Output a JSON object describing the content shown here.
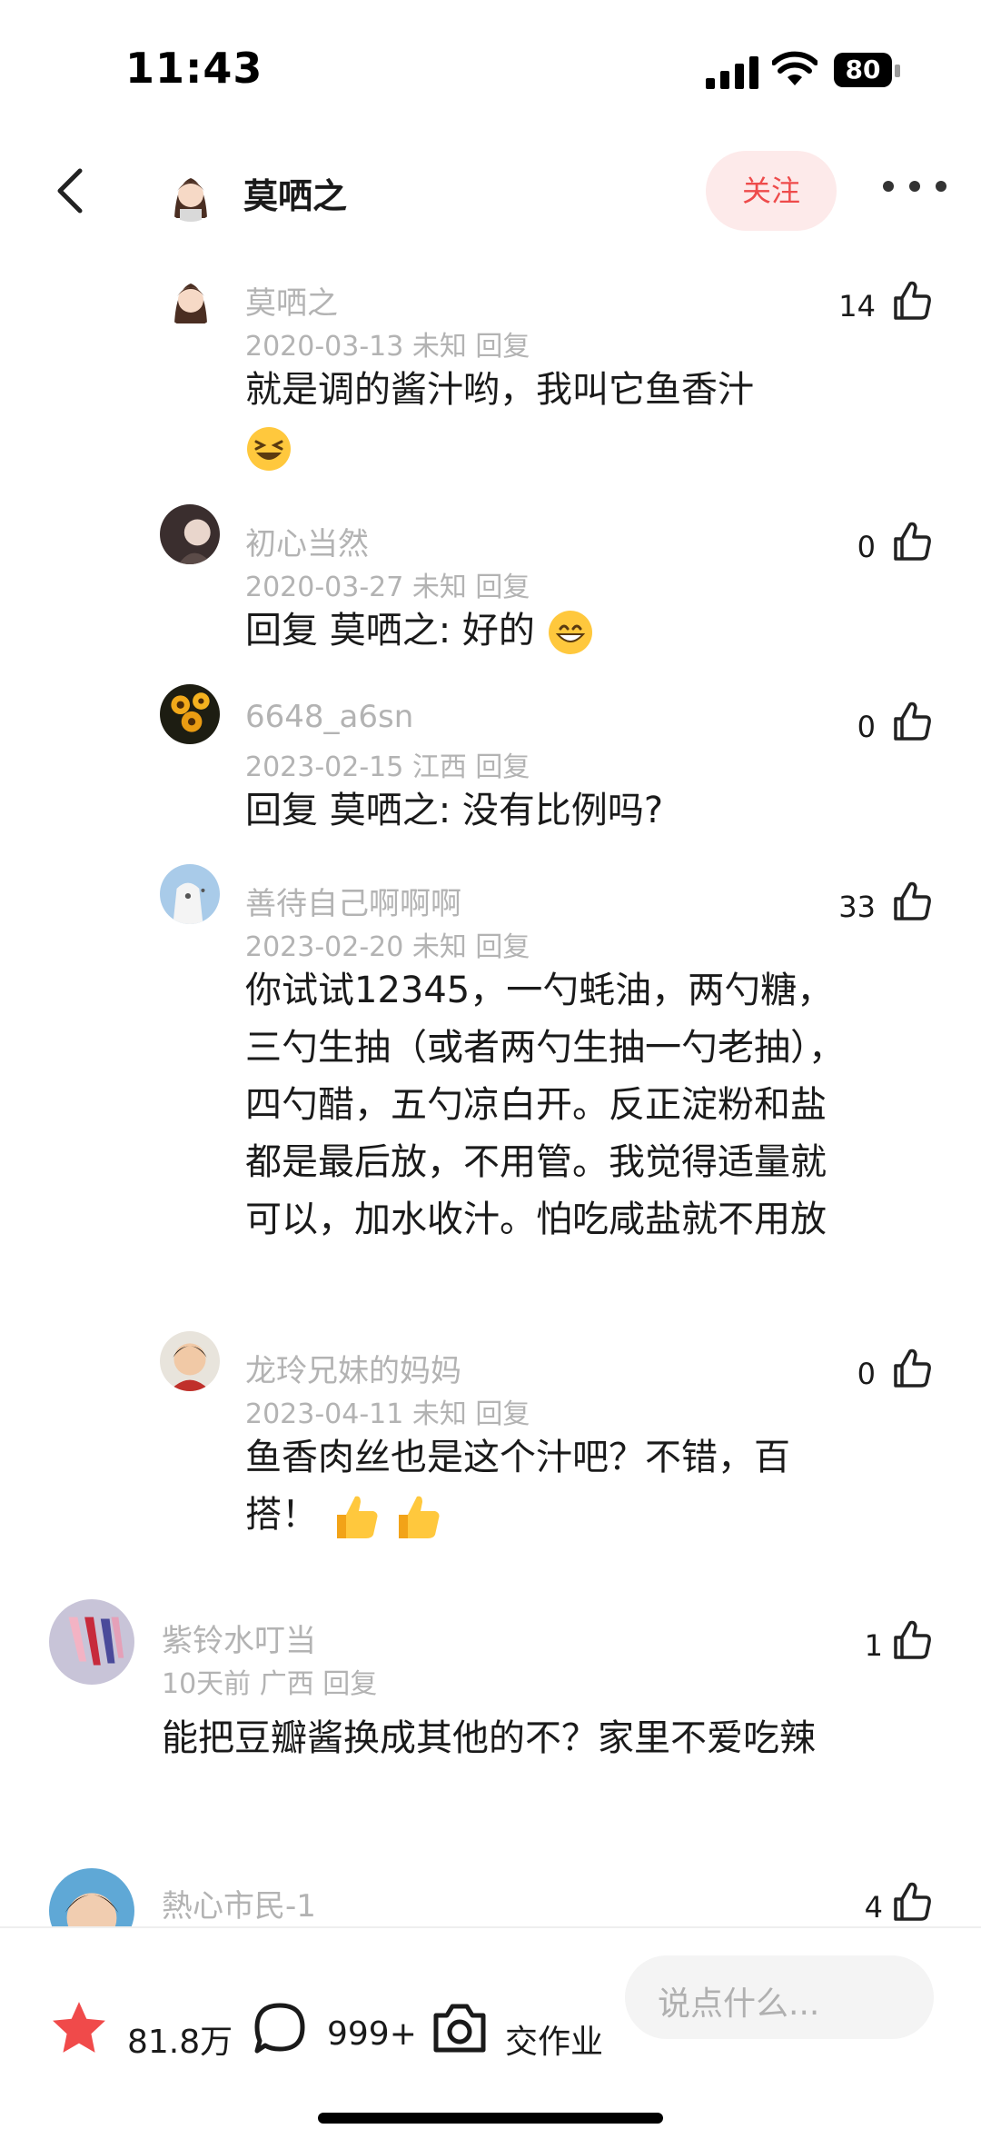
{
  "status_bar": {
    "time": "11:43",
    "battery": "80"
  },
  "header": {
    "author_name": "莫哂之",
    "follow_label": "关注"
  },
  "comments": [
    {
      "name": "莫哂之",
      "meta": "2020-03-13 未知 回复",
      "likes": "14",
      "text": "就是调的酱汁哟，我叫它鱼香汁"
    },
    {
      "name": "初心当然",
      "meta": "2020-03-27 未知 回复",
      "likes": "0",
      "text": "回复 莫哂之: 好的"
    },
    {
      "name": "6648_a6sn",
      "meta": "2023-02-15 江西 回复",
      "likes": "0",
      "text": "回复 莫哂之: 没有比例吗?"
    },
    {
      "name": "善待自己啊啊啊",
      "meta": "2023-02-20 未知 回复",
      "likes": "33",
      "text": "你试试12345，一勺蚝油，两勺糖，三勺生抽（或者两勺生抽一勺老抽），四勺醋，五勺凉白开。反正淀粉和盐都是最后放，不用管。我觉得适量就可以，加水收汁。怕吃咸盐就不用放"
    },
    {
      "name": "龙玲兄妹的妈妈",
      "meta": "2023-04-11 未知 回复",
      "likes": "0",
      "text": "鱼香肉丝也是这个汁吧？不错，百搭！"
    },
    {
      "name": "紫铃水叮当",
      "meta": "10天前 广西 回复",
      "likes": "1",
      "text": "能把豆瓣酱换成其他的不？家里不爱吃辣"
    },
    {
      "name": "熱心市民-1",
      "likes": "4"
    }
  ],
  "bottom_bar": {
    "favorites_count": "81.8万",
    "comments_count": "999+",
    "homework_label": "交作业",
    "input_placeholder": "说点什么..."
  },
  "colors": {
    "follow_text": "#ee4b4b",
    "follow_bg": "#fdeaea",
    "star": "#f04a4a",
    "meta_gray": "#b3b3b3"
  },
  "icons": [
    "back-icon",
    "more-icon",
    "like-icon",
    "star-icon",
    "comment-bubble-icon",
    "camera-icon"
  ]
}
